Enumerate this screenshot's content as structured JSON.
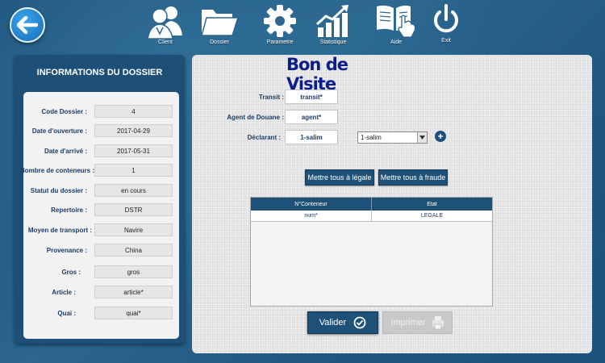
{
  "toolbar": {
    "back": "back-arrow-icon",
    "items": [
      {
        "label": "Client",
        "icon": "client-users-icon"
      },
      {
        "label": "Dossier",
        "icon": "folder-icon"
      },
      {
        "label": "Parametre",
        "icon": "gear-icon"
      },
      {
        "label": "Statistique",
        "icon": "statistics-chart-icon"
      },
      {
        "label": "Aide",
        "icon": "help-book-icon"
      },
      {
        "label": "Exit",
        "icon": "power-icon"
      }
    ]
  },
  "sidebar": {
    "title": "INFORMATIONS DU DOSSIER",
    "fields": [
      {
        "label": "Code Dossier :",
        "value": "4"
      },
      {
        "label": "Date d'ouverture  :",
        "value": "2017-04-29"
      },
      {
        "label": "Date d'arrivé :",
        "value": "2017-05-31"
      },
      {
        "label": "Nombre de conteneurs :",
        "value": "1"
      },
      {
        "label": "Statut du dossier :",
        "value": "en cours"
      },
      {
        "label": "Repertoire :",
        "value": "DSTR"
      },
      {
        "label": "Moyen de transport :",
        "value": "Navire"
      },
      {
        "label": "Provenance :",
        "value": "China"
      },
      {
        "label": "Gros :",
        "value": "gros"
      },
      {
        "label": "Article :",
        "value": "article*"
      },
      {
        "label": "Quai :",
        "value": "quai*"
      }
    ]
  },
  "main": {
    "title": "Bon de Visite",
    "transit_label": "Transit :",
    "transit_value": "transit*",
    "agent_label": "Agent de Douane :",
    "agent_value": "agent*",
    "declarant_label": "Déclarant  :",
    "declarant_value": "1-salim",
    "declarant_select": "1-salim",
    "btn_legale": "Mettre tous à légale",
    "btn_fraude": "Mettre tous à fraude",
    "table": {
      "headers": [
        "N°Conteneur",
        "Etat"
      ],
      "rows": [
        [
          "num*",
          "LEGALE"
        ]
      ]
    },
    "valider": "Valider",
    "imprimer": "Imprimer"
  },
  "colors": {
    "accent": "#1e5177",
    "title": "#0d1d8a",
    "label": "#1a3d66"
  }
}
